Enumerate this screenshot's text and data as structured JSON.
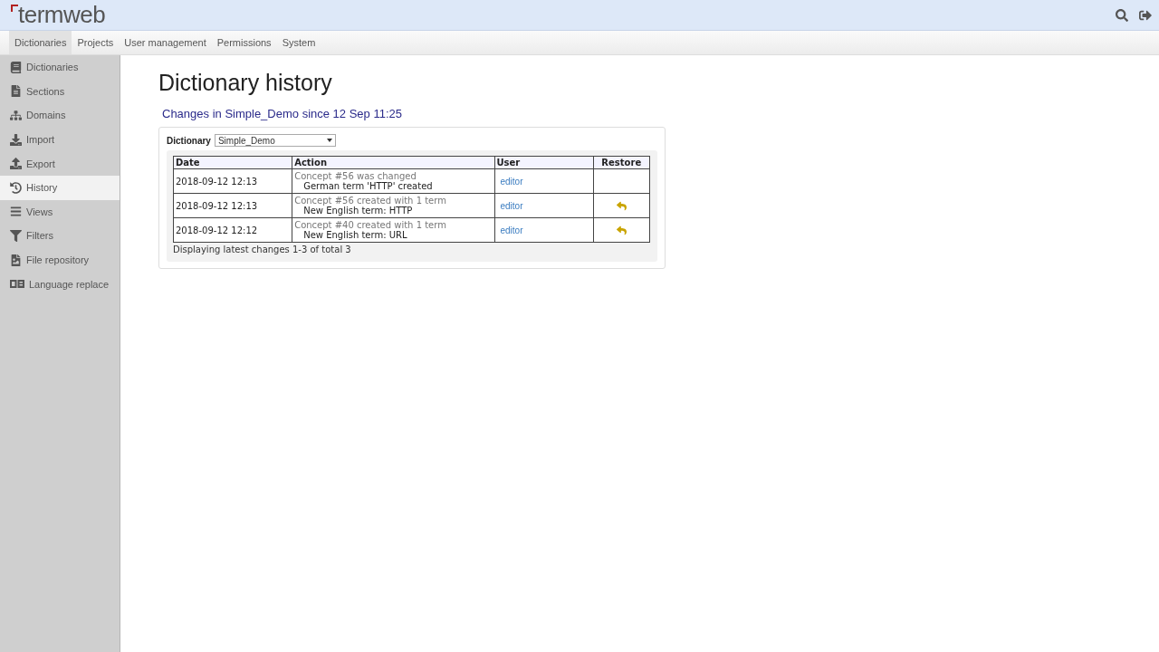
{
  "app": {
    "logo": "termweb"
  },
  "top_nav": [
    {
      "label": "Dictionaries",
      "selected": true
    },
    {
      "label": "Projects",
      "selected": false
    },
    {
      "label": "User management",
      "selected": false
    },
    {
      "label": "Permissions",
      "selected": false
    },
    {
      "label": "System",
      "selected": false
    }
  ],
  "sidebar": {
    "items": [
      {
        "label": "Dictionaries",
        "selected": false
      },
      {
        "label": "Sections",
        "selected": false
      },
      {
        "label": "Domains",
        "selected": false
      },
      {
        "label": "Import",
        "selected": false
      },
      {
        "label": "Export",
        "selected": false
      },
      {
        "label": "History",
        "selected": true
      },
      {
        "label": "Views",
        "selected": false
      },
      {
        "label": "Filters",
        "selected": false
      },
      {
        "label": "File repository",
        "selected": false
      },
      {
        "label": "Language replace",
        "selected": false
      }
    ]
  },
  "page": {
    "title": "Dictionary history",
    "subtitle": "Changes in Simple_Demo since 12 Sep 11:25",
    "dictionary_label": "Dictionary",
    "dictionary_value": "Simple_Demo",
    "table": {
      "columns": [
        "Date",
        "Action",
        "User",
        "Restore"
      ],
      "rows": [
        {
          "date": "2018-09-12 12:13",
          "summary": "Concept #56 was changed",
          "detail": "German term 'HTTP' created",
          "user": "editor",
          "restorable": false
        },
        {
          "date": "2018-09-12 12:13",
          "summary": "Concept #56 created with 1 term",
          "detail": "New English term: HTTP",
          "user": "editor",
          "restorable": true
        },
        {
          "date": "2018-09-12 12:12",
          "summary": "Concept #40 created with 1 term",
          "detail": "New English term: URL",
          "user": "editor",
          "restorable": true
        }
      ]
    },
    "footer": "Displaying latest changes 1-3 of total 3"
  }
}
